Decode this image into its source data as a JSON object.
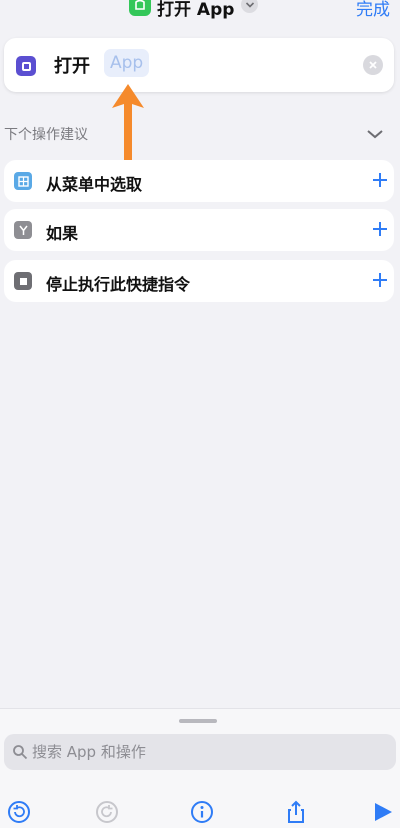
{
  "nav": {
    "title": "打开 App",
    "done_label": "完成"
  },
  "action": {
    "verb": "打开",
    "parameter_placeholder": "App"
  },
  "suggestions": {
    "header": "下个操作建议",
    "items": [
      {
        "label": "从菜单中选取",
        "icon": "menu-icon",
        "icon_color": "#5aa9e6"
      },
      {
        "label": "如果",
        "icon": "branch-icon",
        "icon_color": "#8e8e93"
      },
      {
        "label": "停止执行此快捷指令",
        "icon": "stop-icon",
        "icon_color": "#6e6e73"
      }
    ]
  },
  "search": {
    "placeholder": "搜索 App 和操作"
  },
  "toolbar": {
    "icons": [
      "undo-icon",
      "redo-icon",
      "info-icon",
      "share-icon",
      "play-icon"
    ]
  },
  "colors": {
    "accent": "#2f7cf6",
    "annotation_arrow": "#f58a2c",
    "app_icon": "#34c759",
    "open_app_icon": "#5b4fd1"
  }
}
